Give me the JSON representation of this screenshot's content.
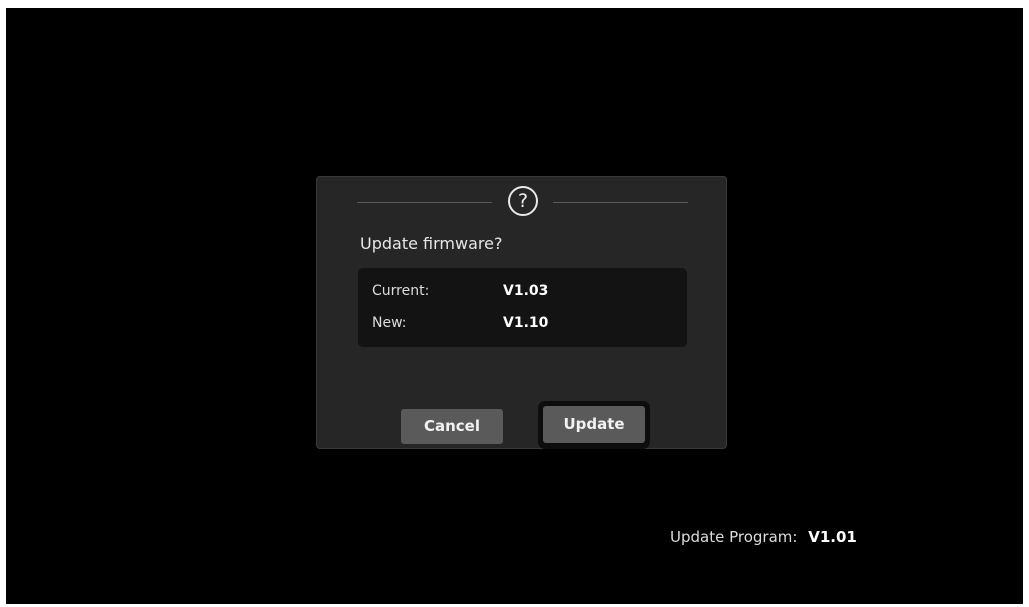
{
  "dialog": {
    "icon": "question-icon",
    "icon_glyph": "?",
    "title": "Update firmware?",
    "current_label": "Current:",
    "current_value": "V1.03",
    "new_label": "New:",
    "new_value": "V1.10",
    "cancel_label": "Cancel",
    "update_label": "Update"
  },
  "footer": {
    "program_label": "Update Program:",
    "program_value": "V1.01"
  },
  "colors": {
    "background": "#000000",
    "dialog": "#262626",
    "panel": "#131313",
    "button": "#5a5a5a",
    "text": "#e6e6e6"
  }
}
